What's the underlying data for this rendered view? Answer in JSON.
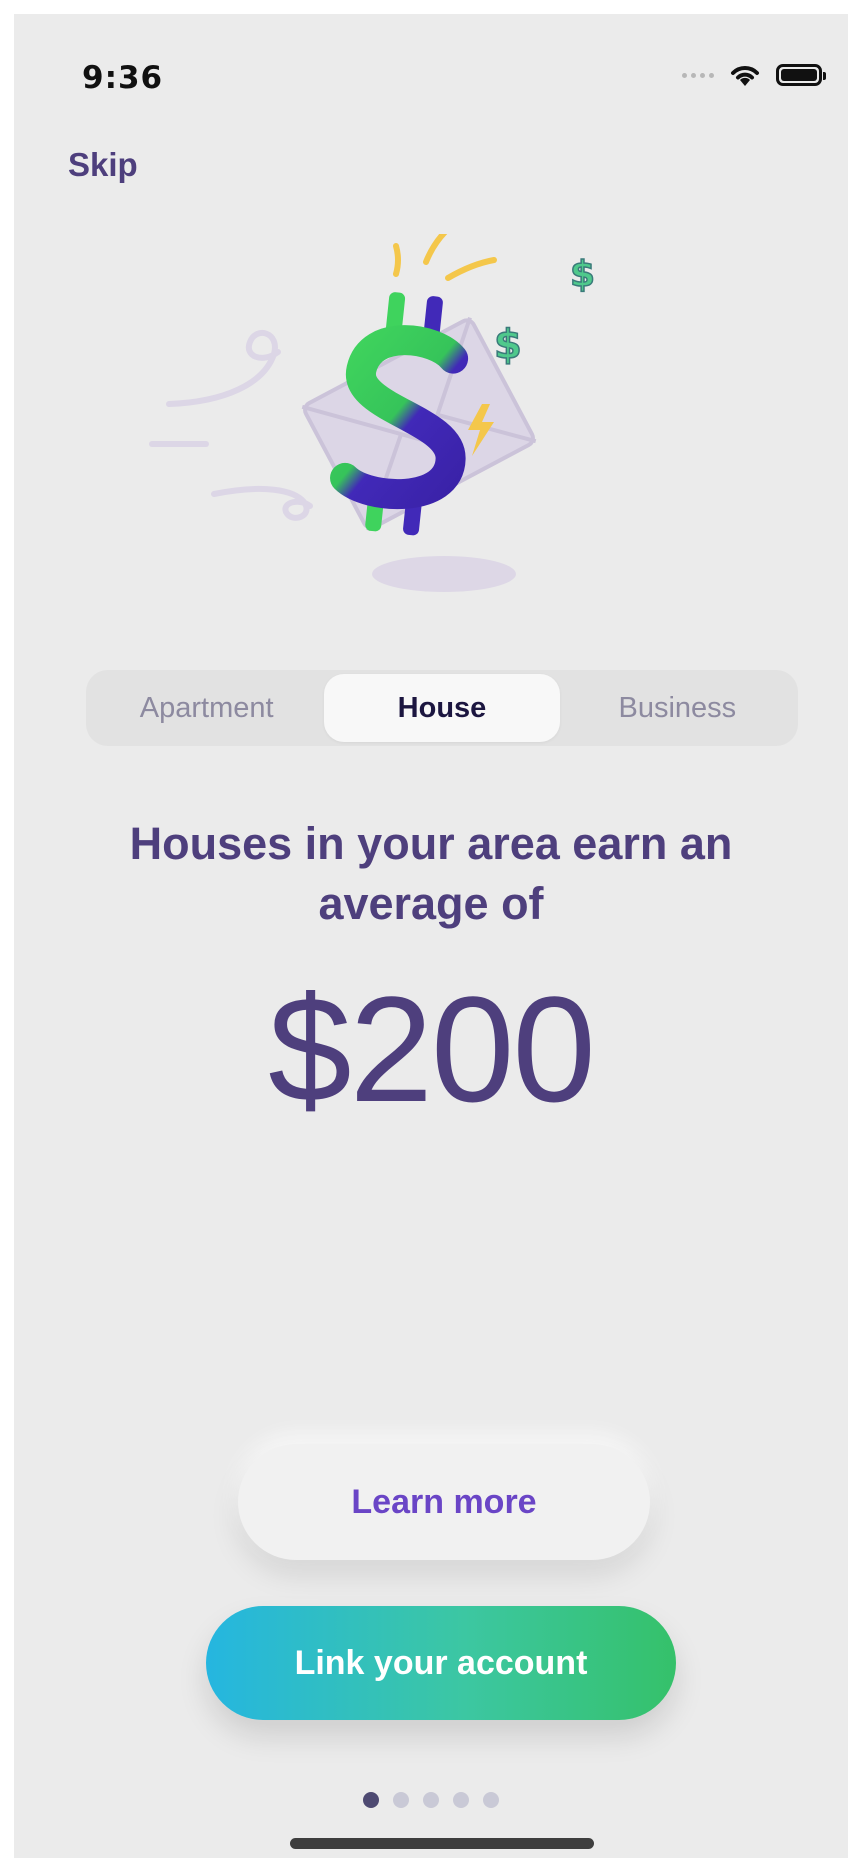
{
  "status_bar": {
    "time": "9:36"
  },
  "header": {
    "skip_label": "Skip"
  },
  "segmented_control": {
    "options": [
      "Apartment",
      "House",
      "Business"
    ],
    "selected": "House"
  },
  "content": {
    "headline": "Houses in your area earn an average of",
    "amount": "$200"
  },
  "actions": {
    "learn_more_label": "Learn more",
    "link_account_label": "Link your account"
  },
  "pagination": {
    "total_pages": 5,
    "current_page": 1
  },
  "colors": {
    "primary_text": "#4e3f7d",
    "accent_purple": "#6a45c6",
    "gradient_start": "#25b6e0",
    "gradient_end": "#35c16a",
    "background": "#ebebeb"
  },
  "icons": [
    "signal-dots-icon",
    "wifi-icon",
    "battery-icon",
    "money-envelope-illustration",
    "dollar-sign-icon",
    "lightning-icon"
  ]
}
